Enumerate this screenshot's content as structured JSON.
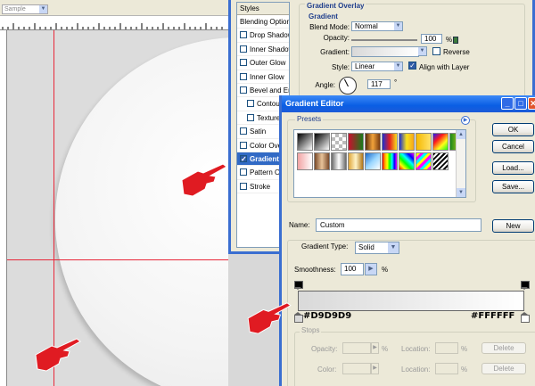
{
  "toolbar": {
    "sample_label": "Sample"
  },
  "layer_style": {
    "styles_header": "Styles",
    "blending_options": "Blending Options: Default",
    "items": [
      {
        "label": "Drop Shadow",
        "checked": false,
        "sub": false,
        "selected": false
      },
      {
        "label": "Inner Shadow",
        "checked": false,
        "sub": false,
        "selected": false
      },
      {
        "label": "Outer Glow",
        "checked": false,
        "sub": false,
        "selected": false
      },
      {
        "label": "Inner Glow",
        "checked": false,
        "sub": false,
        "selected": false
      },
      {
        "label": "Bevel and Emboss",
        "checked": false,
        "sub": false,
        "selected": false
      },
      {
        "label": "Contour",
        "checked": false,
        "sub": true,
        "selected": false
      },
      {
        "label": "Texture",
        "checked": false,
        "sub": true,
        "selected": false
      },
      {
        "label": "Satin",
        "checked": false,
        "sub": false,
        "selected": false
      },
      {
        "label": "Color Overlay",
        "checked": false,
        "sub": false,
        "selected": false
      },
      {
        "label": "Gradient Overlay",
        "checked": true,
        "sub": false,
        "selected": true
      },
      {
        "label": "Pattern Overlay",
        "checked": false,
        "sub": false,
        "selected": false
      },
      {
        "label": "Stroke",
        "checked": false,
        "sub": false,
        "selected": false
      }
    ],
    "overlay": {
      "title": "Gradient Overlay",
      "subtitle": "Gradient",
      "blend_mode_label": "Blend Mode:",
      "blend_mode_value": "Normal",
      "opacity_label": "Opacity:",
      "opacity_value": "100",
      "percent": "%",
      "gradient_label": "Gradient:",
      "reverse_label": "Reverse",
      "reverse_checked": false,
      "style_label": "Style:",
      "style_value": "Linear",
      "align_label": "Align with Layer",
      "align_checked": true,
      "angle_label": "Angle:",
      "angle_value": "117",
      "degree": "°"
    }
  },
  "gradient_editor": {
    "title": "Gradient Editor",
    "presets_label": "Presets",
    "presets_menu_icon": "right-arrow-icon",
    "swatches": [
      "linear-gradient(135deg,#000,#fff)",
      "linear-gradient(135deg,#000,rgba(0,0,0,0))",
      "repeating-conic-gradient(#bbb 0% 25%, #fff 0% 50%) 0 0 / 8px 8px",
      "linear-gradient(90deg,#c8102e,#1a7a1a)",
      "linear-gradient(90deg,#5b2c0c,#f2a33a,#7a3c10)",
      "linear-gradient(90deg,#1b2fd2,#e31f1f,#f7e21b)",
      "linear-gradient(90deg,#1b2fd2,#f7e21b,#f7a51b)",
      "linear-gradient(90deg,#f5b800,#ffe36b)",
      "linear-gradient(135deg,#1a1aff,#ff1a1a,#ffff1a,#1aff1a)",
      "linear-gradient(90deg,#1a8a1a,#ffe51a)",
      "linear-gradient(90deg,#f2a3a3,#fff)",
      "linear-gradient(90deg,#7a4a2a,#e8c49a,#7a4a2a)",
      "linear-gradient(90deg,#6b6b6b,#fff,#6b6b6b)",
      "linear-gradient(90deg,#dfa53a,#fff4c8,#b07515)",
      "linear-gradient(135deg,#1a6acb,#9bd7ff,#fff)",
      "linear-gradient(90deg,red,orange,yellow,lime,cyan,blue,magenta)",
      "linear-gradient(45deg,#ff0000,#ffff00,#00ff00,#00ffff,#0000ff,#ff00ff)",
      "repeating-linear-gradient(135deg,#ffff00 0 3px,#ff00ff 3px 6px,#00ffff 6px 9px)",
      "repeating-linear-gradient(135deg,#000 0 2px,#fff 2px 4px)"
    ],
    "buttons": {
      "ok": "OK",
      "cancel": "Cancel",
      "load": "Load...",
      "save": "Save...",
      "new": "New"
    },
    "name_label": "Name:",
    "name_value": "Custom",
    "gradient_type_label": "Gradient Type:",
    "gradient_type_value": "Solid",
    "smoothness_label": "Smoothness:",
    "smoothness_value": "100",
    "percent": "%",
    "left_color": "#D9D9D9",
    "right_color": "#FFFFFF",
    "stops": {
      "label": "Stops",
      "opacity_label": "Opacity:",
      "percent": "%",
      "location_label": "Location:",
      "color_label": "Color:",
      "delete_label": "Delete"
    }
  },
  "colors": {
    "guide": "#e8283a",
    "hand": "#e01b22",
    "title_bar": "#0a5ee4"
  }
}
